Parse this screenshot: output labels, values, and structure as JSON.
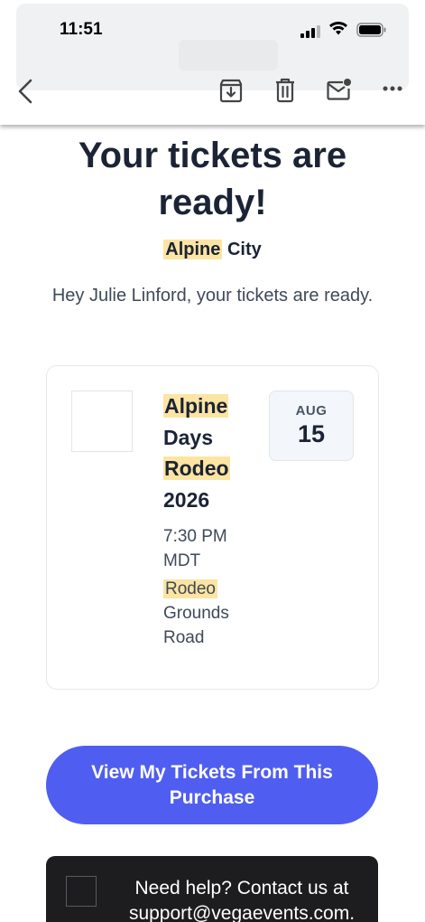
{
  "status_bar": {
    "time": "11:51"
  },
  "toolbar": {
    "back_icon": "chevron-left-icon",
    "archive_icon": "archive-download-icon",
    "trash_icon": "trash-icon",
    "unread_icon": "mark-unread-icon",
    "more_icon": "more-horizontal-icon"
  },
  "email": {
    "headline": "Your tickets are ready!",
    "subhead_highlight": "Alpine",
    "subhead_rest": " City",
    "greeting": "Hey Julie Linford, your tickets are ready.",
    "event": {
      "title_word_1": "Alpine",
      "title_word_2": "Days",
      "title_word_3": "Rodeo",
      "title_word_4": "2026",
      "time": "7:30 PM MDT",
      "venue_highlight": "Rodeo",
      "venue_rest": "Grounds Road",
      "date_month": "AUG",
      "date_day": "15"
    },
    "cta_label": "View My Tickets From This Purchase",
    "help_text": "Need help? Contact us at support@vegaevents.com."
  },
  "colors": {
    "highlight": "#fce4a2",
    "cta": "#4f5ef0",
    "help_bg": "#1d1d1f",
    "heading": "#1b2335"
  }
}
